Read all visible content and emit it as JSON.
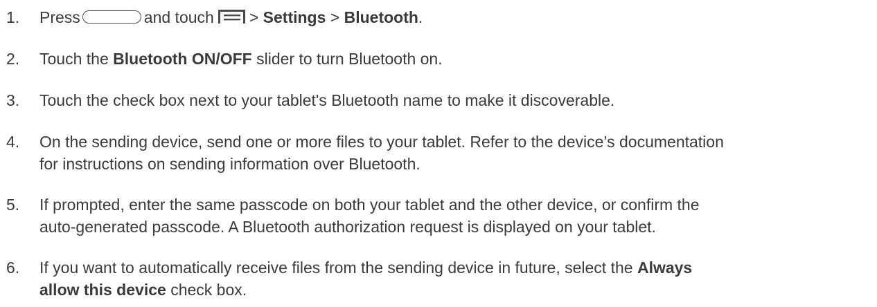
{
  "steps": [
    {
      "number": "1.",
      "pre": "Press",
      "mid": "and touch",
      "sep1": ">",
      "settings": "Settings",
      "sep2": ">",
      "bluetooth": "Bluetooth",
      "end": ".",
      "icons": [
        "home-key-icon",
        "menu-key-icon"
      ]
    },
    {
      "number": "2.",
      "pre": "Touch the",
      "bold": "Bluetooth ON/OFF",
      "post": "slider to turn Bluetooth on."
    },
    {
      "number": "3.",
      "text": "Touch the check box next to your tablet's Bluetooth name to make it discoverable."
    },
    {
      "number": "4.",
      "line1": "On the sending device, send one or more files to your tablet. Refer to the device’s documentation",
      "line2": "for instructions on sending information over Bluetooth."
    },
    {
      "number": "5.",
      "line1": "If prompted, enter the same passcode on both your tablet and the other device, or confirm the",
      "line2": "auto-generated passcode. A Bluetooth authorization request is displayed on your tablet."
    },
    {
      "number": "6.",
      "line1_pre": "If you want to automatically receive files from the sending device in future, select the",
      "line1_bold": "Always",
      "line2_bold": "allow this device",
      "line2_post": "check box."
    }
  ]
}
